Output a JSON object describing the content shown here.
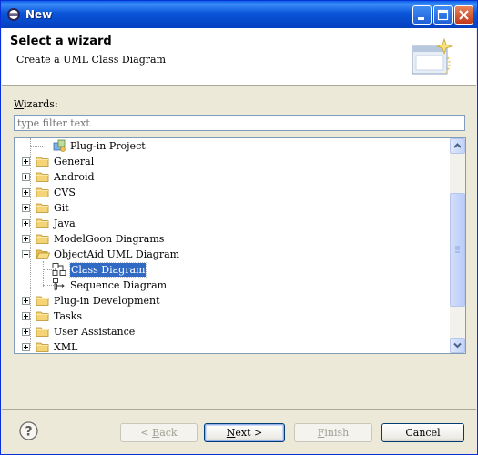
{
  "window": {
    "title": "New"
  },
  "header": {
    "title": "Select a wizard",
    "description": "Create a UML Class Diagram"
  },
  "wizards_label": {
    "mnemonic": "W",
    "rest": "izards:"
  },
  "filter": {
    "value": "",
    "placeholder": "type filter text"
  },
  "tree": {
    "items": [
      {
        "label": "Plug-in Project",
        "depth": 1,
        "expander": "none",
        "icon": "plugin-project-icon"
      },
      {
        "label": "General",
        "depth": 0,
        "expander": "plus",
        "icon": "folder-icon"
      },
      {
        "label": "Android",
        "depth": 0,
        "expander": "plus",
        "icon": "folder-icon"
      },
      {
        "label": "CVS",
        "depth": 0,
        "expander": "plus",
        "icon": "folder-icon"
      },
      {
        "label": "Git",
        "depth": 0,
        "expander": "plus",
        "icon": "folder-icon"
      },
      {
        "label": "Java",
        "depth": 0,
        "expander": "plus",
        "icon": "folder-icon"
      },
      {
        "label": "ModelGoon Diagrams",
        "depth": 0,
        "expander": "plus",
        "icon": "folder-icon"
      },
      {
        "label": "ObjectAid UML Diagram",
        "depth": 0,
        "expander": "minus",
        "icon": "folder-open-icon"
      },
      {
        "label": "Class Diagram",
        "depth": 1,
        "expander": "none",
        "icon": "class-diagram-icon",
        "selected": true
      },
      {
        "label": "Sequence Diagram",
        "depth": 1,
        "expander": "none",
        "icon": "sequence-diagram-icon"
      },
      {
        "label": "Plug-in Development",
        "depth": 0,
        "expander": "plus",
        "icon": "folder-icon"
      },
      {
        "label": "Tasks",
        "depth": 0,
        "expander": "plus",
        "icon": "folder-icon"
      },
      {
        "label": "User Assistance",
        "depth": 0,
        "expander": "plus",
        "icon": "folder-icon"
      },
      {
        "label": "XML",
        "depth": 0,
        "expander": "plus",
        "icon": "folder-icon"
      }
    ]
  },
  "buttons": {
    "back": {
      "prefix": "< ",
      "mnemonic": "B",
      "rest": "ack",
      "enabled": false
    },
    "next": {
      "prefix": "",
      "mnemonic": "N",
      "rest": "ext >",
      "enabled": true
    },
    "finish": {
      "prefix": "",
      "mnemonic": "F",
      "rest": "inish",
      "enabled": false
    },
    "cancel": {
      "label": "Cancel",
      "enabled": true
    }
  },
  "colors": {
    "titlebar": "#0a55d8",
    "selection": "#316ac5",
    "folder": "#f5d476"
  }
}
